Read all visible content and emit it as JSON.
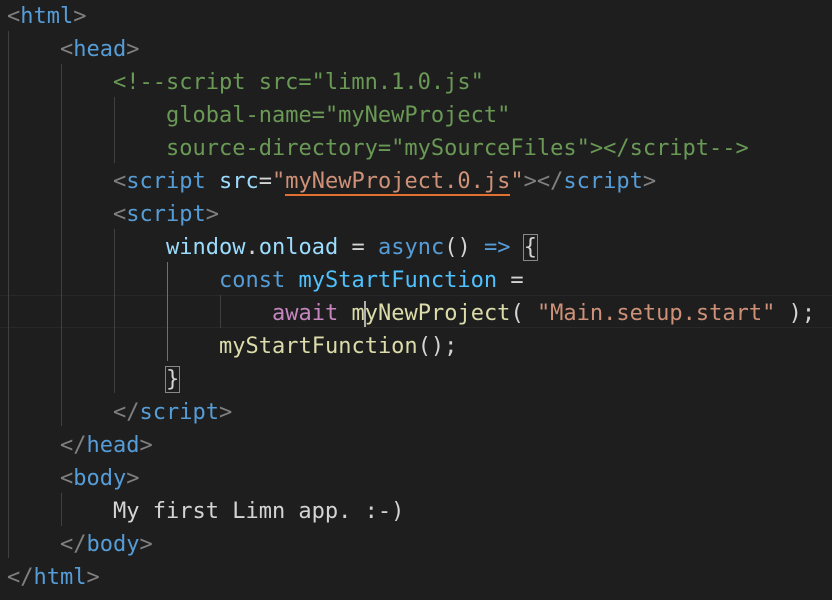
{
  "editor": {
    "language": "html",
    "theme_colors": {
      "background": "#1e1e1e",
      "tag": "#569cd6",
      "attribute": "#9cdcfe",
      "string": "#ce9178",
      "comment": "#6a9955",
      "keyword": "#569cd6",
      "control_keyword": "#c586c0",
      "punctuation": "#808080",
      "text": "#d4d4d4"
    },
    "cursor_line": 10,
    "lines": {
      "l1": {
        "open": "<",
        "tag": "html",
        "close": ">"
      },
      "l2": {
        "open": "<",
        "tag": "head",
        "close": ">"
      },
      "l3": {
        "text": "<!--script src=\"limn.1.0.js\""
      },
      "l4": {
        "text": "global-name=\"myNewProject\""
      },
      "l5": {
        "text": "source-directory=\"mySourceFiles\"></script-->"
      },
      "l6": {
        "open": "<",
        "tag": "script",
        "space": " ",
        "attr": "src",
        "eq": "=",
        "quote_open": "\"",
        "value": "myNewProject.0.js",
        "quote_close": "\"",
        "close_open": "></",
        "close_tag": "script",
        "close": ">"
      },
      "l7": {
        "open": "<",
        "tag": "script",
        "close": ">"
      },
      "l8": {
        "obj": "window",
        "dot": ".",
        "prop": "onload",
        "op": " = ",
        "kw": "async",
        "params": "() ",
        "arrow": "=>",
        "space": " ",
        "brace": "{"
      },
      "l9": {
        "kw": "const",
        "space": " ",
        "name": "myStartFunction",
        "op": " ="
      },
      "l10": {
        "kw": "await",
        "space": " ",
        "fn_a": "m",
        "fn_b": "yNewProject",
        "paren_open": "( ",
        "arg": "\"Main.setup.start\"",
        "paren_close": " );"
      },
      "l11": {
        "fn": "myStartFunction",
        "punc": "();"
      },
      "l12": {
        "brace": "}"
      },
      "l13": {
        "open": "</",
        "tag": "script",
        "close": ">"
      },
      "l14": {
        "open": "</",
        "tag": "head",
        "close": ">"
      },
      "l15": {
        "open": "<",
        "tag": "body",
        "close": ">"
      },
      "l16": {
        "text": "My first Limn app. :-)"
      },
      "l17": {
        "open": "</",
        "tag": "body",
        "close": ">"
      },
      "l18": {
        "open": "</",
        "tag": "html",
        "close": ">"
      }
    }
  }
}
